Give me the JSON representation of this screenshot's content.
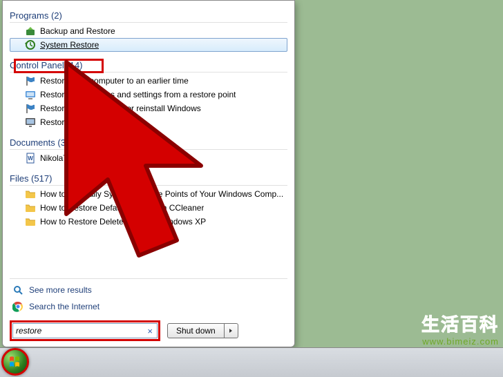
{
  "search": {
    "value": "restore",
    "shutdown_label": "Shut down"
  },
  "groups": [
    {
      "header": "Programs (2)",
      "items": [
        {
          "icon": "backup-restore-icon",
          "label": "Backup and Restore",
          "highlighted": false
        },
        {
          "icon": "system-restore-icon",
          "label": "System Restore",
          "highlighted": true
        }
      ]
    },
    {
      "header": "Control Panel (14)",
      "items": [
        {
          "icon": "flag-icon",
          "label": "Restore your computer to an earlier time",
          "highlighted": false
        },
        {
          "icon": "system-icon",
          "label": "Restore system files and settings from a restore point",
          "highlighted": false
        },
        {
          "icon": "flag-icon",
          "label": "Restore your computer or reinstall Windows",
          "highlighted": false
        },
        {
          "icon": "monitor-icon",
          "label": "Restore Start Menu Defaults",
          "highlighted": false
        }
      ]
    },
    {
      "header": "Documents (3)",
      "items": [
        {
          "icon": "word-doc-icon",
          "label": "NikolaTesla_secrets",
          "highlighted": false
        }
      ]
    },
    {
      "header": "Files (517)",
      "items": [
        {
          "icon": "folder-icon",
          "label": "How to Manually System Restore Points of Your Windows Comp...",
          "highlighted": false
        },
        {
          "icon": "folder-icon",
          "label": "How to Restore Default Settings in CCleaner",
          "highlighted": false
        },
        {
          "icon": "folder-icon",
          "label": "How to Restore Deleted Files in Windows XP",
          "highlighted": false
        }
      ]
    }
  ],
  "bottom_links": {
    "more": "See more results",
    "internet": "Search the Internet"
  },
  "watermark": {
    "cn": "生活百科",
    "url": "www.bimeiz.com"
  }
}
